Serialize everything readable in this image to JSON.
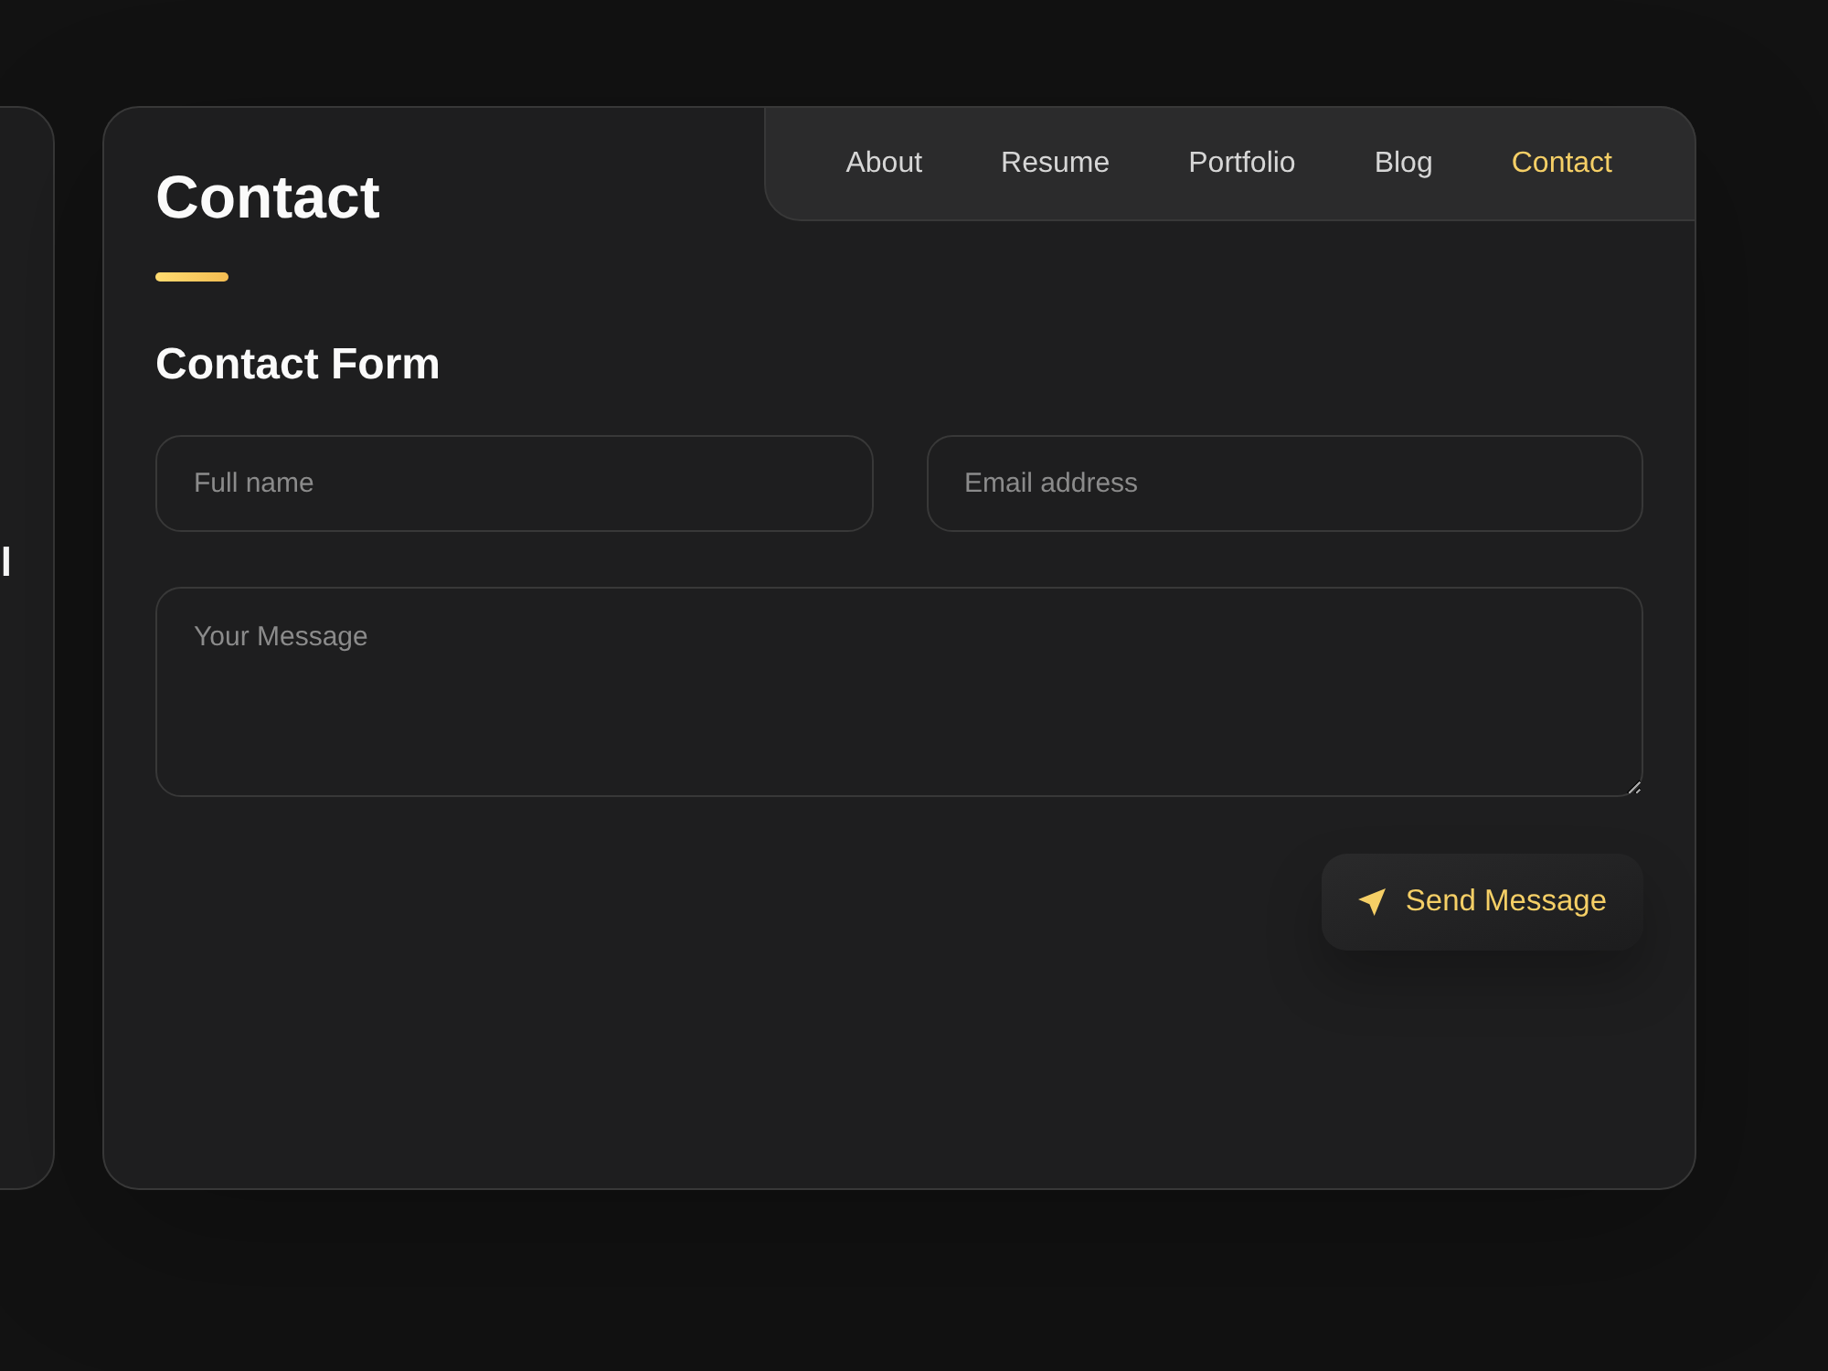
{
  "sidebar": {
    "text": "l"
  },
  "navbar": {
    "items": [
      {
        "label": "About",
        "selected": false
      },
      {
        "label": "Resume",
        "selected": false
      },
      {
        "label": "Portfolio",
        "selected": false
      },
      {
        "label": "Blog",
        "selected": false
      },
      {
        "label": "Contact",
        "selected": true
      }
    ]
  },
  "article": {
    "title": "Contact",
    "section_title": "Contact Form",
    "form": {
      "fields": [
        {
          "kind": "input",
          "placeholder": "Full name"
        },
        {
          "kind": "input",
          "placeholder": "Email address"
        },
        {
          "kind": "textarea",
          "placeholder": "Your Message"
        }
      ],
      "submit": {
        "label": "Send Message"
      }
    }
  }
}
